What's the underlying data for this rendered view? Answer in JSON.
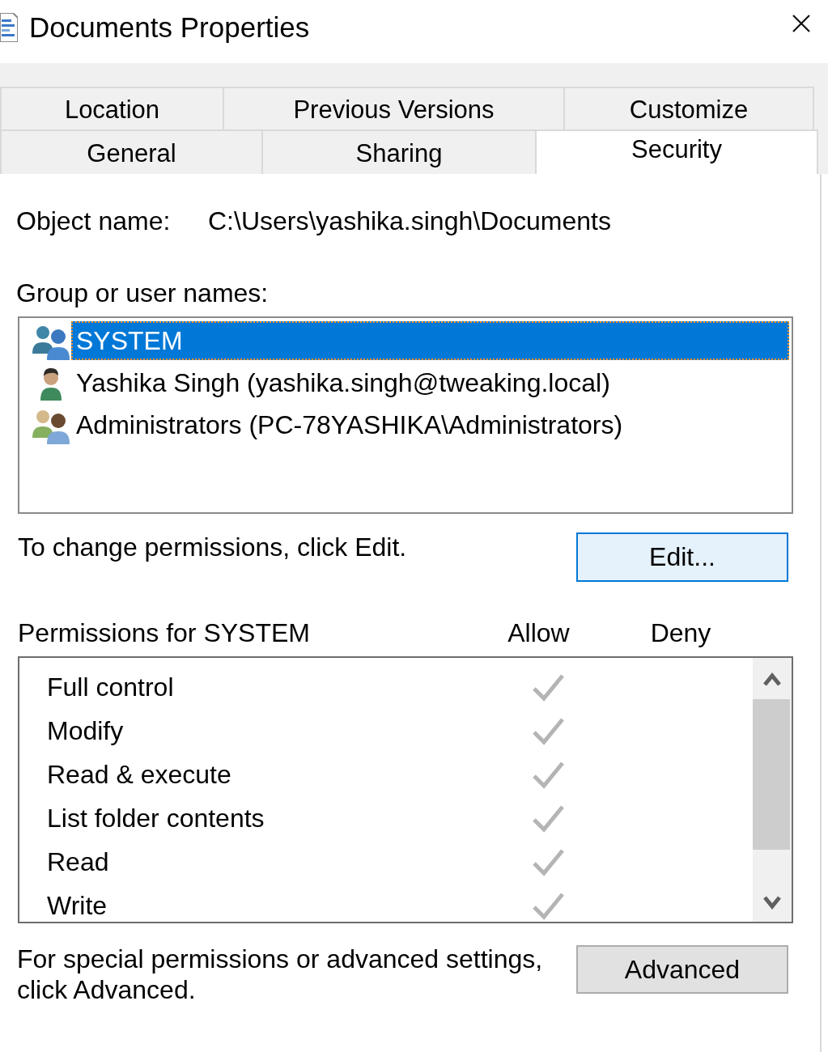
{
  "window": {
    "title": "Documents Properties"
  },
  "tabs": {
    "back_row": [
      {
        "label": "Location",
        "selected": false
      },
      {
        "label": "Previous Versions",
        "selected": false
      },
      {
        "label": "Customize",
        "selected": false
      }
    ],
    "front_row": [
      {
        "label": "General",
        "selected": false
      },
      {
        "label": "Sharing",
        "selected": false
      },
      {
        "label": "Security",
        "selected": true
      }
    ]
  },
  "object_name": {
    "label": "Object name:",
    "value": "C:\\Users\\yashika.singh\\Documents"
  },
  "groups": {
    "label": "Group or user names:",
    "items": [
      {
        "name": "SYSTEM",
        "kind": "system",
        "selected": true
      },
      {
        "name": "Yashika Singh (yashika.singh@tweaking.local)",
        "kind": "user",
        "selected": false
      },
      {
        "name": "Administrators (PC-78YASHIKA\\Administrators)",
        "kind": "admins",
        "selected": false
      }
    ]
  },
  "edit": {
    "hint": "To change permissions, click Edit.",
    "button": {
      "label": "Edit...",
      "default": true
    }
  },
  "permissions": {
    "title": "Permissions for SYSTEM",
    "columns": [
      "Allow",
      "Deny"
    ],
    "rows": [
      {
        "name": "Full control",
        "allow": true,
        "deny": false
      },
      {
        "name": "Modify",
        "allow": true,
        "deny": false
      },
      {
        "name": "Read & execute",
        "allow": true,
        "deny": false
      },
      {
        "name": "List folder contents",
        "allow": true,
        "deny": false
      },
      {
        "name": "Read",
        "allow": true,
        "deny": false
      },
      {
        "name": "Write",
        "allow": true,
        "deny": false
      }
    ]
  },
  "advanced": {
    "hint": "For special permissions or advanced settings, click Advanced.",
    "button": {
      "label": "Advanced",
      "default": false
    }
  }
}
